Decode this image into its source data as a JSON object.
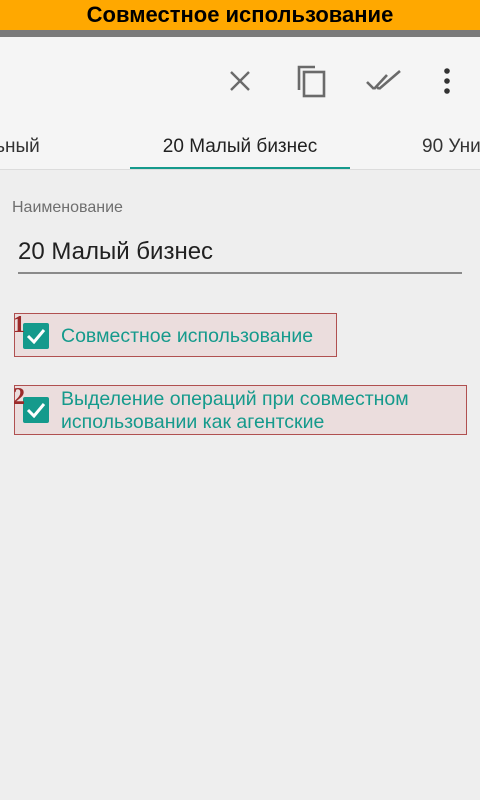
{
  "banner": {
    "title": "Совместное использование"
  },
  "toolbar": {
    "actions": [
      {
        "icon": "close-icon"
      },
      {
        "icon": "copy-icon"
      },
      {
        "icon": "done-all-icon"
      },
      {
        "icon": "more-vert-icon"
      }
    ]
  },
  "tabs": [
    {
      "label": "льный"
    },
    {
      "label": "20 Малый бизнес",
      "active": true
    },
    {
      "label": "90 Уни"
    }
  ],
  "form": {
    "name_label": "Наименование",
    "name_value": "20 Малый бизнес"
  },
  "checkboxes": [
    {
      "marker": "1",
      "label": "Совместное использование",
      "checked": true
    },
    {
      "marker": "2",
      "label": "Выделение операций при совместном использовании как агентские",
      "checked": true
    }
  ],
  "colors": {
    "accent": "#159a8c",
    "banner": "#ffa800",
    "annotation": "#9b2a2a"
  }
}
